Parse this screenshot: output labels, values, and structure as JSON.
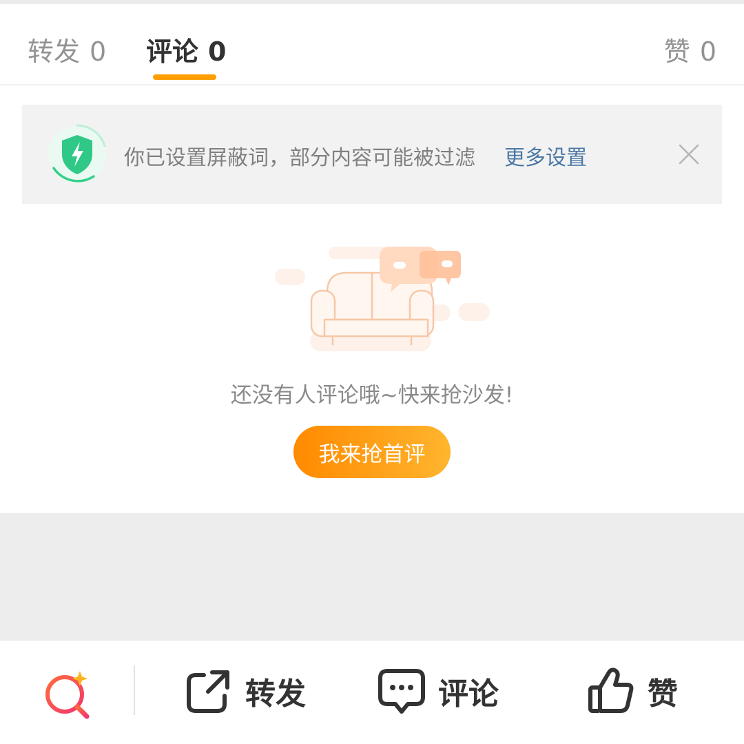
{
  "tabs": [
    {
      "label": "转发",
      "count": "0"
    },
    {
      "label": "评论",
      "count": "0"
    },
    {
      "label": "赞",
      "count": "0"
    }
  ],
  "active_tab": "评论",
  "notice": {
    "text": "你已设置屏蔽词，部分内容可能被过滤",
    "link": "更多设置"
  },
  "empty_state": {
    "message": "还没有人评论哦~快来抢沙发!",
    "button": "我来抢首评"
  },
  "bottom_bar": {
    "repost": "转发",
    "comment": "评论",
    "like": "赞"
  },
  "colors": {
    "accent": "#ff9e00",
    "link": "#4b78a6",
    "shield": "#2fc886"
  },
  "icons": [
    "shield-lightning-icon",
    "close-icon",
    "sofa-illustration",
    "search-sparkle-icon",
    "share-icon",
    "comment-bubble-icon",
    "thumbs-up-icon"
  ]
}
